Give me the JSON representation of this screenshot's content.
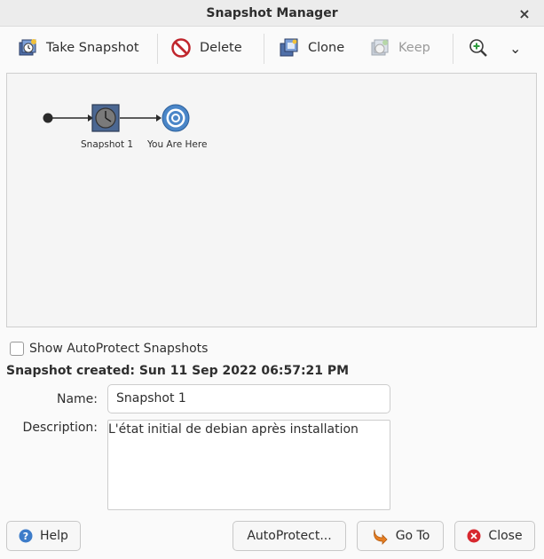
{
  "window": {
    "title": "Snapshot Manager",
    "close_glyph": "×"
  },
  "toolbar": {
    "take_snapshot": "Take Snapshot",
    "delete": "Delete",
    "clone": "Clone",
    "keep": "Keep",
    "dropdown_glyph": "⌄"
  },
  "tree": {
    "nodes": [
      {
        "label": "Snapshot 1",
        "icon": "clock-icon"
      },
      {
        "label": "You Are Here",
        "icon": "target-icon"
      }
    ]
  },
  "show_autoprotect": {
    "label": "Show AutoProtect Snapshots",
    "checked": false
  },
  "details": {
    "created": "Snapshot created: Sun 11 Sep 2022 06:57:21 PM",
    "name_label": "Name:",
    "name_value": "Snapshot 1",
    "description_label": "Description:",
    "description_value": "L'état initial de debian après installation"
  },
  "buttons": {
    "help": "Help",
    "autoprotect": "AutoProtect...",
    "goto": "Go To",
    "close": "Close"
  },
  "colors": {
    "delete_red": "#c0262d",
    "close_red": "#d7282f",
    "help_blue": "#3d7cc9",
    "target_blue": "#4a86c8",
    "goto_orange": "#e67e22",
    "zoom_green": "#2e9b3e"
  }
}
